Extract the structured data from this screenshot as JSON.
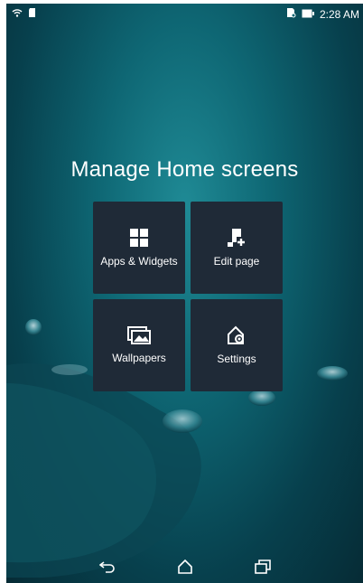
{
  "status": {
    "time": "2:28 AM",
    "icons": [
      "wifi-icon",
      "sd-card-icon",
      "no-sim-icon",
      "battery-icon"
    ]
  },
  "title": "Manage Home screens",
  "tiles": [
    {
      "label": "Apps & Widgets",
      "icon": "apps-grid-icon"
    },
    {
      "label": "Edit page",
      "icon": "edit-page-icon"
    },
    {
      "label": "Wallpapers",
      "icon": "wallpaper-icon"
    },
    {
      "label": "Settings",
      "icon": "home-settings-icon"
    }
  ],
  "navbar": [
    "back-icon",
    "home-icon",
    "recents-icon"
  ]
}
